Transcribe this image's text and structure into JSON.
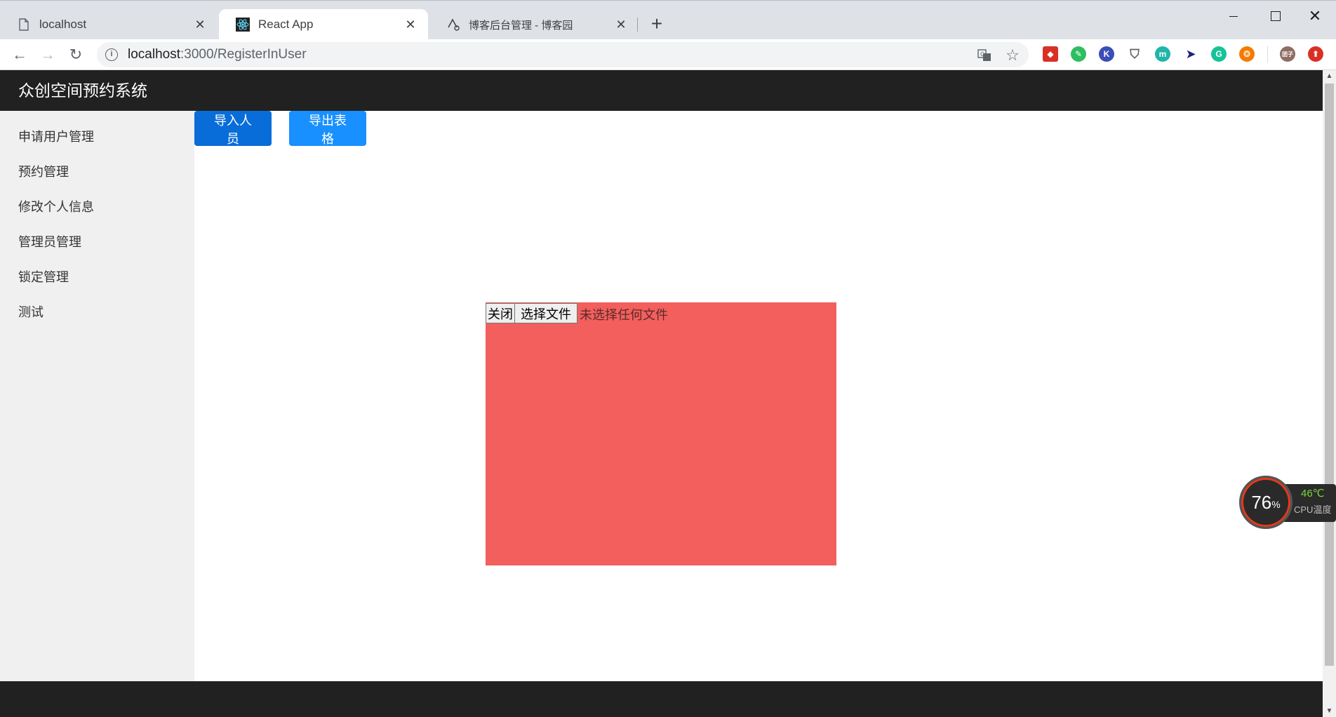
{
  "browser": {
    "tabs": [
      {
        "title": "localhost",
        "active": false,
        "icon": "page-icon"
      },
      {
        "title": "React App",
        "active": true,
        "icon": "react-icon"
      },
      {
        "title": "博客后台管理 - 博客园",
        "active": false,
        "icon": "cnblogs-icon"
      }
    ],
    "url": {
      "host": "localhost",
      "path": ":3000/RegisterInUser"
    },
    "extensions": [
      {
        "name": "extension-red-icon",
        "color": "#d93025",
        "glyph": "◆"
      },
      {
        "name": "evernote-icon",
        "color": "#2dbe60",
        "glyph": "✎"
      },
      {
        "name": "extension-k-icon",
        "color": "#3b4db8",
        "glyph": "K"
      },
      {
        "name": "bookmark-icon",
        "color": "#ffffff",
        "glyph": "🔖"
      },
      {
        "name": "extension-m-icon",
        "color": "#1fb5a8",
        "glyph": "m"
      },
      {
        "name": "cursor-extension-icon",
        "color": "#ffffff",
        "glyph": "▶"
      },
      {
        "name": "grammarly-icon",
        "color": "#15c39a",
        "glyph": "G"
      },
      {
        "name": "extension-orange-icon",
        "color": "#f57c00",
        "glyph": "❂"
      },
      {
        "name": "profile-avatar-icon",
        "color": "#8d6e63",
        "glyph": "团子"
      },
      {
        "name": "update-icon",
        "color": "#d93025",
        "glyph": "⬆"
      }
    ]
  },
  "app": {
    "title": "众创空间预约系统",
    "menu": [
      {
        "label": "申请用户管理"
      },
      {
        "label": "预约管理"
      },
      {
        "label": "修改个人信息"
      },
      {
        "label": "管理员管理"
      },
      {
        "label": "锁定管理"
      },
      {
        "label": "测试"
      }
    ],
    "buttons": {
      "import": "导入人员",
      "export": "导出表格"
    },
    "modal": {
      "close_label": "关闭",
      "file_button": "选择文件",
      "file_status": "未选择任何文件",
      "background": "#f25f5c"
    }
  },
  "cpu_widget": {
    "usage": "76",
    "usage_unit": "%",
    "temperature": "46℃",
    "label": "CPU温度"
  }
}
